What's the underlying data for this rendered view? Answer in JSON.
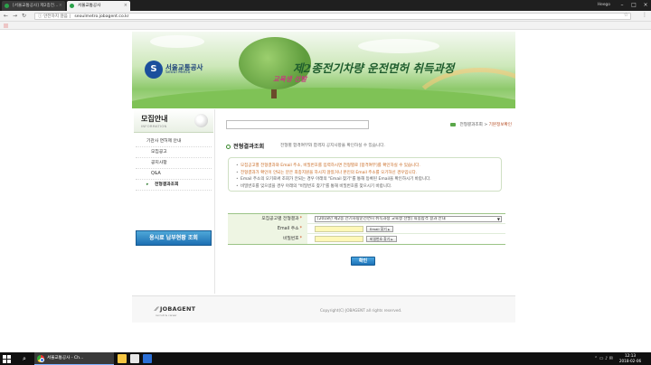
{
  "browser": {
    "tabs": [
      {
        "title": "[서울교통공사] 제2종전..."
      },
      {
        "title": "서울교통공사"
      }
    ],
    "profile": "Heego",
    "address": {
      "security_label": "안전하지 않음",
      "url": "seoulmetro.jobagent.co.kr"
    }
  },
  "banner": {
    "logo_name": "서울교통공사",
    "logo_sub": "Seoul Metro",
    "logo_mark": "S",
    "title": "제2종전기차량 운전면허 취득과정",
    "subtitle": "교육생 선발"
  },
  "sidebar": {
    "title": "모집안내",
    "subtitle": "INFORMATION",
    "items": [
      {
        "label": "기관사 면허제 안내"
      },
      {
        "label": "모집공고"
      },
      {
        "label": "공지사항"
      },
      {
        "label": "Q&A"
      },
      {
        "label": "전형결과조회"
      }
    ],
    "banner_label": "응시료 납부현황 조회"
  },
  "content": {
    "breadcrumb": {
      "parent": "전형결과조회",
      "separator": ">",
      "current": "기본정보확인"
    },
    "section_title": "전형결과조회",
    "section_desc": "전형별 합격여부와 합격자 공지사항을 확인하실 수 있습니다.",
    "notices": [
      {
        "text": "모집공고별 전형결과와 Email 주소, 비밀번호를 입력하시면 전형별로 [합격여부]를 확인하실 수 있습니다.",
        "style": "orange"
      },
      {
        "text": "전형결과가 확인이 안되는 분은 최종지원을 하시지 않았거나 본인의 Email 주소를 오기하신 경우입니다.",
        "style": "orange"
      },
      {
        "text": "Email 주소의 오기로써 조회가 안되는 경우 아래의 \"Email 찾기\"를 통해 등록된 Email을 확인하시기 바랍니다.",
        "style": "normal"
      },
      {
        "text": "비밀번호를 잊으셨을 경우 아래의 \"비밀번호 찾기\"를 통해 비밀번호를 찾으시기 바랍니다.",
        "style": "normal"
      }
    ],
    "form": {
      "select_label": "모집공고별 전형결과",
      "select_value": "[2018년 제2종 전기차량운전면허 취득과정 교육생 선발] 최종합격 결과 안내",
      "email_label": "Email 주소",
      "email_value": "",
      "email_find_button": "Email 찾기",
      "password_label": "비밀번호",
      "password_value": "",
      "password_find_button": "비밀번호 찾기",
      "required_mark": "*"
    },
    "submit_label": "확인"
  },
  "footer": {
    "logo": "JOBAGENT",
    "logo_tag": "recruit & career",
    "copyright": "Copyright(C) JOBAGENT all rights reserved."
  },
  "taskbar": {
    "app_label": "서울교통공사 - Ch...",
    "time": "12:13",
    "date": "2018-02-06"
  },
  "colors": {
    "accent_green": "#3a8a2e",
    "form_label_bg": "#eef5e3",
    "button_blue": "#1d72b8",
    "notice_orange": "#c8671e",
    "input_yellow": "#fff8b8"
  }
}
